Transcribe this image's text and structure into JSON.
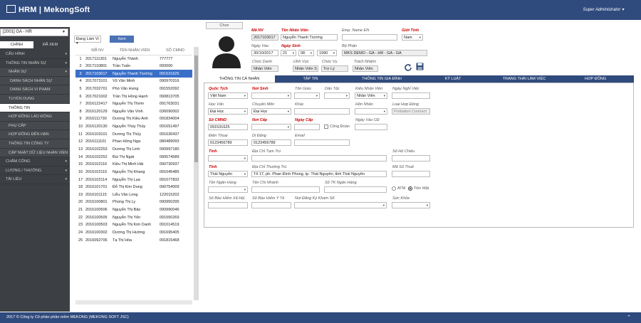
{
  "app": {
    "brand": "HRM | MekongSoft",
    "user": "Super Administrator"
  },
  "sidebar": {
    "company": "[2001] GA - HR",
    "tab_main": "CHÍNH",
    "tab_viewed": "ĐÃ XEM",
    "menu": [
      {
        "label": "CẤU HÌNH",
        "arrow": true,
        "type": "top"
      },
      {
        "label": "THÔNG TIN NHÂN SỰ",
        "arrow": true,
        "type": "top"
      },
      {
        "label": "NHÂN SỰ",
        "arrow": true,
        "type": "sub"
      },
      {
        "label": "DANH SÁCH NHÂN SỰ",
        "type": "sub2"
      },
      {
        "label": "DANH SÁCH VI PHẠM",
        "type": "sub2"
      },
      {
        "label": "TUYỂN DỤNG",
        "type": "sub"
      },
      {
        "label": "THÔNG TIN",
        "type": "active"
      },
      {
        "label": "HỢP ĐỒNG LAO ĐỘNG",
        "type": "sub"
      },
      {
        "label": "PHỤ CẤP",
        "type": "sub"
      },
      {
        "label": "HỢP ĐỒNG ĐẾN HẠN",
        "type": "sub"
      },
      {
        "label": "THÔNG TIN CÔNG TY",
        "type": "sub"
      },
      {
        "label": "CẬP NHẬT DỮ LIỆU NHÂN VIÊN",
        "type": "sub"
      },
      {
        "label": "CHẤM CÔNG",
        "arrow": true,
        "type": "top"
      },
      {
        "label": "LƯƠNG / THƯỞNG",
        "arrow": true,
        "type": "top"
      },
      {
        "label": "TÀI LIỆU",
        "arrow": true,
        "type": "top"
      }
    ]
  },
  "list": {
    "filter": "Đang Làm Vi",
    "view_button": "Xem",
    "columns": [
      "",
      "MÃ NV",
      "TÊN NHÂN VIÊN",
      "SỐ CMND"
    ],
    "rows": [
      [
        "1",
        "2017111301",
        "Nguyễn Thành",
        "777777"
      ],
      [
        "2",
        "2017110801",
        "Trần Tuấn",
        "000000"
      ],
      [
        "3",
        "2017103017",
        "Nguyễn Thanh Trường",
        "091531625"
      ],
      [
        "4",
        "2017073101",
        "Vũ Văn Minh",
        "090970316"
      ],
      [
        "5",
        "2017032701",
        "Phó Văn Hưng",
        "091552092"
      ],
      [
        "6",
        "2017021002",
        "Trần Thị Hồng Hạnh",
        "090813705"
      ],
      [
        "7",
        "2016122417",
        "Nguyễn Thị Thơm",
        "091763031"
      ],
      [
        "8",
        "2016120129",
        "Nguyễn Văn Vinh",
        "036090002"
      ],
      [
        "9",
        "2016111730",
        "Dương Thị Kiều Anh",
        "091834004"
      ],
      [
        "10",
        "2016120130",
        "Nguyễn Thùy Thủy",
        "091651497"
      ],
      [
        "11",
        "2016103101",
        "Dương Thị Thủy",
        "091630437"
      ],
      [
        "12",
        "2016111101",
        "Phan Hồng Nga",
        "080489093"
      ],
      [
        "13",
        "2016102253",
        "Dương Thị Linh",
        "090997180"
      ],
      [
        "14",
        "2016102252",
        "Bùi Thị Ngát",
        "090574589"
      ],
      [
        "15",
        "2016102116",
        "Kiều Thị Minh Hải",
        "090730937"
      ],
      [
        "16",
        "2016102115",
        "Nguyễn Thị Khang",
        "091045485"
      ],
      [
        "17",
        "2016102114",
        "Nguyễn Thị Lụa",
        "091077832"
      ],
      [
        "18",
        "2016101701",
        "Đỗ Thị Kim Dung",
        "090754009"
      ],
      [
        "19",
        "2016101115",
        "Liễu Văn Long",
        "122015202"
      ],
      [
        "20",
        "2016100801",
        "Phùng Thị Ly",
        "090950295"
      ],
      [
        "21",
        "2016100506",
        "Nguyễn Thị Bảo",
        "090990046"
      ],
      [
        "22",
        "2016100505",
        "Nguyễn Thị Yến",
        "091550269"
      ],
      [
        "23",
        "2016100503",
        "Nguyễn Thị Kim Oanh",
        "091014519"
      ],
      [
        "24",
        "2016100302",
        "Dương Thị Hường",
        "091695405"
      ],
      [
        "25",
        "2016092706",
        "Tạ Thị Hòa",
        "091815468"
      ]
    ],
    "selected_index": 2
  },
  "form": {
    "choose_button": "Chọn",
    "ma_nv_label": "Mã NV",
    "ma_nv": "2017103017",
    "ten_nv_label": "Tên Nhân Viên",
    "ten_nv": "Nguyễn Thanh Trường",
    "emp_en_label": "Emp. Name EN",
    "emp_en": "",
    "gioi_tinh_label": "Giới Tính",
    "gioi_tinh": "Nam",
    "ngay_vao_label": "Ngày Vào",
    "ngay_vao": "30/10/2017",
    "ngay_sinh_label": "Ngày Sinh",
    "ns_d": "21",
    "ns_m": "08",
    "ns_y": "1990",
    "bo_phan_label": "Bộ Phận",
    "bo_phan": "MKS DEMO - GA - HR - GA - GA",
    "chuc_danh_label": "Chức Danh",
    "chuc_danh": "Nhân Viên",
    "linh_vuc_label": "Lĩnh Vực",
    "linh_vuc": "Nhân Viên S",
    "chuc_vu_label": "Chức Vụ",
    "chuc_vu": "Trợ Lý",
    "trach_nhiem_label": "Trách Nhiệm",
    "trach_nhiem": "Nhân Viên",
    "tabs": [
      "THÔNG TIN CÁ NHÂN",
      "TẬP TIN",
      "THÔNG TIN GIA ĐÌNH",
      "KỶ LUẬT",
      "TRẠNG THÁI LÀM VIỆC",
      "HỢP ĐỒNG"
    ],
    "quoc_tich_label": "Quốc Tịch",
    "quoc_tich": "Việt Nam",
    "noi_sinh_label": "Nơi Sinh",
    "noi_sinh": "",
    "ton_giao_label": "Tôn Giáo",
    "ton_giao": "",
    "dan_toc_label": "Dân Tộc",
    "dan_toc": "",
    "kieu_nv_label": "Kiểu Nhân Viên",
    "kieu_nv": "Nhân Viên",
    "ngay_nghi_label": "Ngày Nghỉ Việc",
    "ngay_nghi": "",
    "hoc_van_label": "Học Vấn",
    "hoc_van": "Đại Học",
    "chuyen_mon_label": "Chuyên Môn",
    "chuyen_mon": "Đại Học",
    "khac_label": "Khác",
    "khac": "",
    "hon_nhan_label": "Hôn Nhân",
    "hon_nhan": "",
    "loai_hd_label": "Loại Hợp Đồng",
    "loai_hd": "Probation Contract",
    "so_cmnd_label": "Số CMND",
    "so_cmnd": "091531625",
    "noi_cap_label": "Nơi Cấp",
    "noi_cap": "",
    "ngay_cap_label": "Ngày Cấp",
    "cong_doan_label": "Công Đoàn",
    "ngay_vao_cd_label": "Ngày Vào CĐ",
    "ngay_vao_cd": "",
    "dien_thoai_label": "Điện Thoại",
    "dien_thoai": "0123456789",
    "di_dong_label": "Di Động",
    "di_dong": "0123456789",
    "email_label": "Email",
    "email": "",
    "tinh1_label": "Tỉnh",
    "tinh1": "",
    "dc_tam_tru_label": "Địa Chỉ Tạm Trú",
    "dc_tam_tru": "",
    "so_ho_chieu_label": "Số Hộ Chiếu",
    "so_ho_chieu": "",
    "tinh2_label": "Tỉnh",
    "tinh2": "Thái Nguyên",
    "dc_thuong_tru_label": "Địa Chỉ Thường Trú",
    "dc_thuong_tru": "Tổ 17, ph. Phan Đình Phùng, tp. Thái Nguyên, tỉnh Thái Nguyên",
    "ma_so_thue_label": "Mã Số Thuế",
    "ma_so_thue": "",
    "ten_ngan_hang_label": "Tên Ngân Hàng",
    "ten_ngan_hang": "",
    "ten_chi_nhanh_label": "Tên Chi Nhánh",
    "ten_chi_nhanh": "",
    "so_tk_label": "Số TK Ngân Hàng",
    "so_tk": "",
    "atm_label": "ATM",
    "tien_mat_label": "Tiền Mặt",
    "bhxh_label": "Số Bảo Hiểm Xã Hội",
    "bhyt_label": "Số Bảo Hiểm Y Tế",
    "kham_sk_label": "Nơi Đăng Ký Khám SK",
    "suc_khoe_label": "Sức Khỏe"
  },
  "footer": "2017 © Công ty Cổ phần phần mềm MEKONG (MEKONG SOFT JSC)"
}
